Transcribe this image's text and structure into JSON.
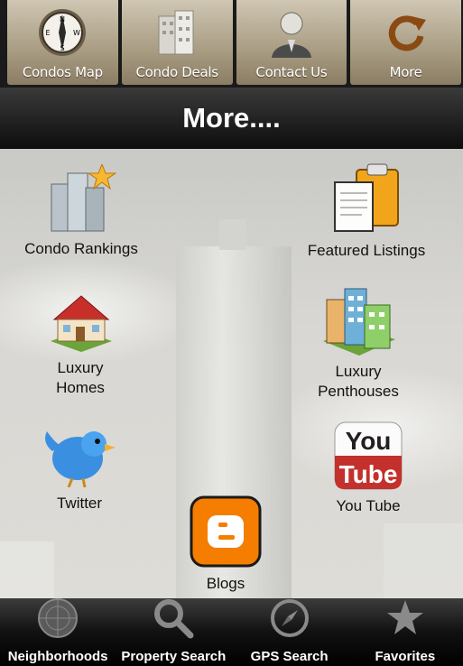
{
  "top_tabs": [
    {
      "label": "Condos Map",
      "icon": "compass-icon"
    },
    {
      "label": "Condo Deals",
      "icon": "buildings-icon"
    },
    {
      "label": "Contact Us",
      "icon": "person-icon"
    },
    {
      "label": "More",
      "icon": "refresh-arrow-icon"
    }
  ],
  "header": {
    "title": "More...."
  },
  "items": [
    {
      "label": "Condo Rankings",
      "icon": "star-buildings-icon"
    },
    {
      "label": "Featured Listings",
      "icon": "clipboard-icon"
    },
    {
      "label": "Luxury\nHomes",
      "icon": "house-icon"
    },
    {
      "label": "Luxury\nPenthouses",
      "icon": "apartment-icon"
    },
    {
      "label": "Twitter",
      "icon": "twitter-bird-icon"
    },
    {
      "label": "You Tube",
      "icon": "youtube-icon"
    },
    {
      "label": "Blogs",
      "icon": "blogger-icon"
    }
  ],
  "bottom_tabs": [
    {
      "label": "Neighborhoods",
      "icon": "radar-icon"
    },
    {
      "label": "Property Search",
      "icon": "magnifier-icon"
    },
    {
      "label": "GPS Search",
      "icon": "compass-needle-icon"
    },
    {
      "label": "Favorites",
      "icon": "star-icon"
    }
  ],
  "colors": {
    "accent": "#f7b731",
    "bar": "#1a1a1a",
    "tab": "#a89c82",
    "blogger": "#f57d00",
    "youtube": "#c4302b"
  }
}
